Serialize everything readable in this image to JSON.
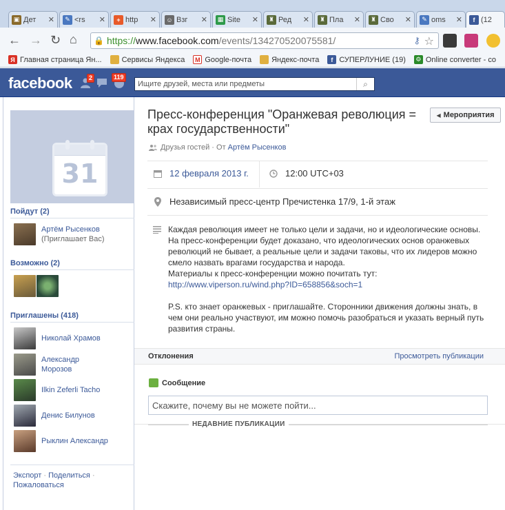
{
  "browser": {
    "tabs": [
      {
        "title": "Дет",
        "icon": "app-icon",
        "color": "#8a6a2a"
      },
      {
        "title": "<rs",
        "icon": "feed-icon",
        "color": "#4a78c0"
      },
      {
        "title": "http",
        "icon": "plus-icon",
        "color": "#e85a2a"
      },
      {
        "title": "Взг",
        "icon": "person-icon",
        "color": "#6a6a6a"
      },
      {
        "title": "Site",
        "icon": "sheet-icon",
        "color": "#2e9a4a"
      },
      {
        "title": "Ред",
        "icon": "helmet-icon",
        "color": "#5a6a3a"
      },
      {
        "title": "Пла",
        "icon": "helmet-icon",
        "color": "#5a6a3a"
      },
      {
        "title": "Сво",
        "icon": "helmet-icon",
        "color": "#5a6a3a"
      },
      {
        "title": "oms",
        "icon": "pencil-icon",
        "color": "#4a78c0"
      },
      {
        "title": "(12",
        "icon": "facebook-icon",
        "color": "#3b5998"
      }
    ],
    "url_scheme": "https://",
    "url_host": "www.facebook.com",
    "url_path": "/events/134270520075581/",
    "bookmarks": [
      {
        "label": "Главная страница Ян...",
        "icon": "yandex-icon",
        "color": "#d93025"
      },
      {
        "label": "Сервисы Яндекса",
        "icon": "folder-icon",
        "color": "#e0b040"
      },
      {
        "label": "Google-почта",
        "icon": "gmail-icon",
        "color": "#d93025"
      },
      {
        "label": "Яндекс-почта",
        "icon": "mail-icon",
        "color": "#e0b040"
      },
      {
        "label": "СУПЕРЛУНИЕ (19)",
        "icon": "facebook-icon",
        "color": "#3b5998"
      },
      {
        "label": "Online converter - co",
        "icon": "converter-icon",
        "color": "#2a8a2a"
      }
    ]
  },
  "facebook": {
    "logo": "facebook",
    "friend_badge": "2",
    "notif_badge": "119",
    "search_placeholder": "Ищите друзей, места или предметы"
  },
  "sidebar": {
    "calendar_day": "31",
    "going_title": "Пойдут (2)",
    "going": [
      {
        "name": "Артём Рысенков",
        "sub": "(Приглашает Вас)"
      }
    ],
    "maybe_title": "Возможно (2)",
    "invited_title": "Приглашены (418)",
    "invited": [
      {
        "name": "Николай Храмов"
      },
      {
        "name": "Александр Морозов"
      },
      {
        "name": "Ilkin Zeferli Tacho"
      },
      {
        "name": "Денис Билунов"
      },
      {
        "name": "Рыклин Александр"
      }
    ],
    "footer_export": "Экспорт",
    "footer_share": "Поделиться",
    "footer_report": "Пожаловаться",
    "footer_dot": "·"
  },
  "event": {
    "title": "Пресс-конференция \"Оранжевая революция = крах государственности\"",
    "back_label": "Мероприятия",
    "privacy": "Друзья гостей",
    "from_label": "· От",
    "host": "Артём Рысенков",
    "date": "12 февраля 2013 г.",
    "time": "12:00 UTC+03",
    "location": "Независимый пресс-центр Пречистенка 17/9, 1-й этаж",
    "desc_p1": "Каждая революция имеет не только цели и задачи, но и идеологические основы. На пресс-конференции будет доказано, что идеологических основ оранжевых революций не бывает, а реальные цели и задачи таковы, что их лидеров можно смело назвать врагами государства и народа.",
    "desc_p1b": "Материалы к пресс-конференции можно почитать тут:",
    "desc_url": "http://www.viperson.ru/wind.php?ID=658856&soch=1",
    "desc_p2": "P.S. кто знает оранжевых - приглашайте. Сторонники движения должны знать, в чем они реально участвуют, им можно помочь разобраться и указать верный путь развития страны.",
    "decline_title": "Отклонения",
    "view_posts": "Просмотреть публикации",
    "message_label": "Сообщение",
    "message_placeholder": "Скажите, почему вы не можете пойти...",
    "recent_posts": "НЕДАВНИЕ ПУБЛИКАЦИИ"
  }
}
